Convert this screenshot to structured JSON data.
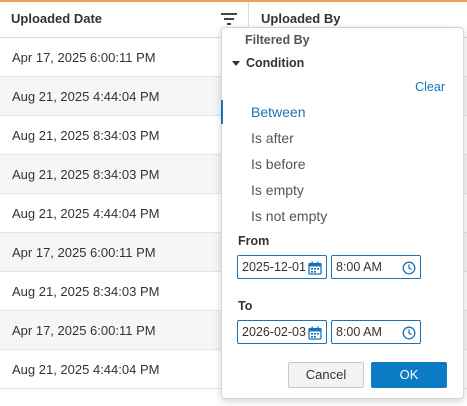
{
  "table": {
    "columns": [
      "Uploaded Date",
      "Uploaded By"
    ],
    "rows": [
      "Apr 17, 2025 6:00:11 PM",
      "Aug 21, 2025 4:44:04 PM",
      "Aug 21, 2025 8:34:03 PM",
      "Aug 21, 2025 8:34:03 PM",
      "Aug 21, 2025 4:44:04 PM",
      "Apr 17, 2025 6:00:11 PM",
      "Aug 21, 2025 8:34:03 PM",
      "Apr 17, 2025 6:00:11 PM",
      "Aug 21, 2025 4:44:04 PM"
    ]
  },
  "filter": {
    "title": "Filtered By",
    "section": "Condition",
    "clear_label": "Clear",
    "options": [
      "Between",
      "Is after",
      "Is before",
      "Is empty",
      "Is not empty"
    ],
    "selected_option": "Between",
    "from_label": "From",
    "from_date": "2025-12-01",
    "from_time": "8:00 AM",
    "to_label": "To",
    "to_date": "2026-02-03",
    "to_time": "8:00 AM",
    "cancel_label": "Cancel",
    "ok_label": "OK"
  },
  "icons": {
    "filter": "filter-icon",
    "calendar": "calendar-icon",
    "clock": "clock-icon",
    "caret": "caret-down-icon"
  },
  "colors": {
    "accent": "#0a7bc4",
    "link": "#1a73b8",
    "header_top_border": "#f0a050"
  }
}
